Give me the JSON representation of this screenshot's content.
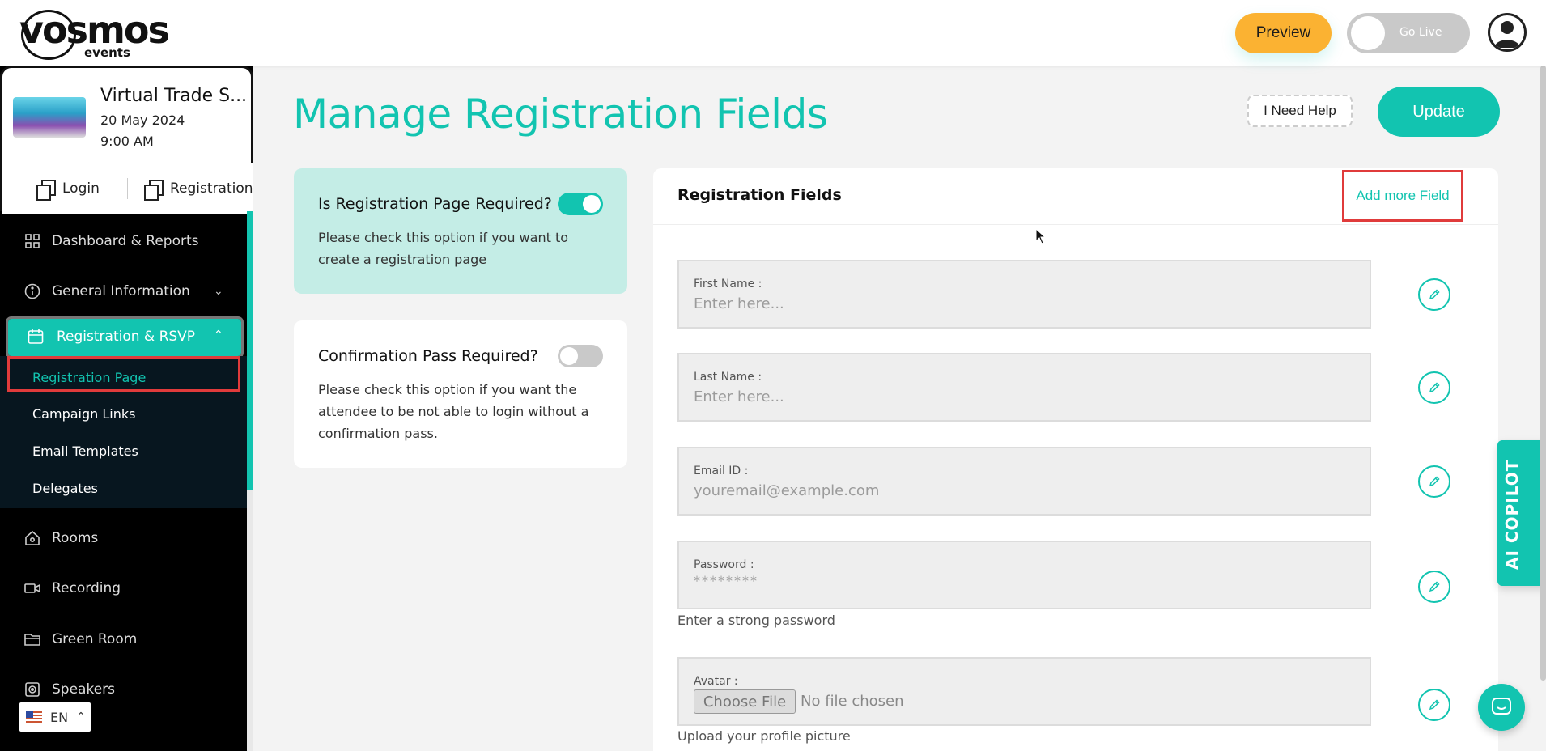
{
  "header": {
    "logo_word": "vosmos",
    "logo_sub": "events",
    "preview_label": "Preview",
    "golive_label": "Go Live"
  },
  "event": {
    "title": "Virtual Trade S...",
    "date": "20 May 2024",
    "time": "9:00 AM",
    "quick_login": "Login",
    "quick_registration": "Registration"
  },
  "sidebar": {
    "items": [
      {
        "label": "Dashboard & Reports",
        "icon": "grid-icon"
      },
      {
        "label": "General Information",
        "icon": "info-icon"
      },
      {
        "label": "Registration & RSVP",
        "icon": "calendar-icon"
      },
      {
        "label": "Rooms",
        "icon": "home-icon"
      },
      {
        "label": "Recording",
        "icon": "video-icon"
      },
      {
        "label": "Green Room",
        "icon": "folder-icon"
      },
      {
        "label": "Speakers",
        "icon": "speaker-icon"
      }
    ],
    "subitems": [
      {
        "label": "Registration Page"
      },
      {
        "label": "Campaign Links"
      },
      {
        "label": "Email Templates"
      },
      {
        "label": "Delegates"
      }
    ],
    "language": "EN"
  },
  "main": {
    "title": "Manage Registration Fields",
    "help_label": "I Need Help",
    "update_label": "Update",
    "reg_required": {
      "title": "Is Registration Page Required?",
      "text": "Please check this option if you want to create a registration page",
      "enabled": true
    },
    "confirm_pass": {
      "title": "Confirmation Pass Required?",
      "text": "Please check this option if you want the attendee to be not able to login without a confirmation pass.",
      "enabled": false
    },
    "fields_panel": {
      "title": "Registration Fields",
      "add_label": "Add more Field",
      "fields": [
        {
          "label": "First Name :",
          "placeholder": "Enter here..."
        },
        {
          "label": "Last Name :",
          "placeholder": "Enter here..."
        },
        {
          "label": "Email ID :",
          "placeholder": "youremail@example.com"
        },
        {
          "label": "Password :",
          "placeholder": "********",
          "hint": "Enter a strong password"
        },
        {
          "label": "Avatar :",
          "file_button": "Choose File",
          "file_status": "No file chosen",
          "hint": "Upload your profile picture"
        }
      ]
    }
  },
  "copilot_label": "AI COPILOT",
  "colors": {
    "accent": "#12c4b0",
    "preview": "#fbb232",
    "highlight": "#e03b3b"
  }
}
